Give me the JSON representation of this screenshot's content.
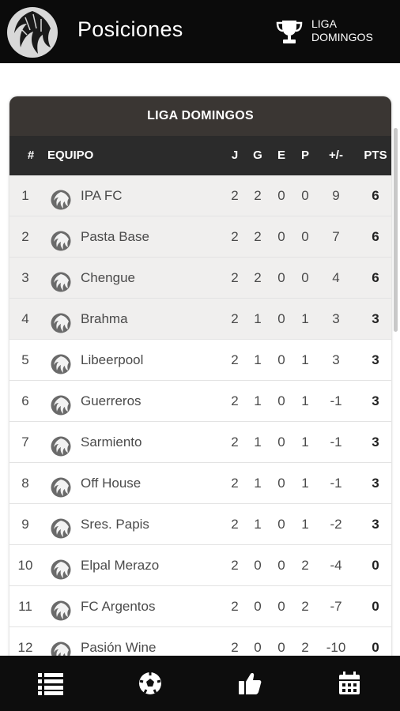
{
  "header": {
    "title": "Posiciones",
    "league_button": "LIGA DOMINGOS"
  },
  "table": {
    "title": "LIGA DOMINGOS",
    "columns": {
      "pos": "#",
      "team": "EQUIPO",
      "j": "J",
      "g": "G",
      "e": "E",
      "p": "P",
      "diff": "+/-",
      "pts": "PTS"
    },
    "rows": [
      {
        "pos": "1",
        "team": "IPA FC",
        "j": "2",
        "g": "2",
        "e": "0",
        "p": "0",
        "diff": "9",
        "pts": "6"
      },
      {
        "pos": "2",
        "team": "Pasta Base",
        "j": "2",
        "g": "2",
        "e": "0",
        "p": "0",
        "diff": "7",
        "pts": "6"
      },
      {
        "pos": "3",
        "team": "Chengue",
        "j": "2",
        "g": "2",
        "e": "0",
        "p": "0",
        "diff": "4",
        "pts": "6"
      },
      {
        "pos": "4",
        "team": "Brahma",
        "j": "2",
        "g": "1",
        "e": "0",
        "p": "1",
        "diff": "3",
        "pts": "3"
      },
      {
        "pos": "5",
        "team": "Libeerpool",
        "j": "2",
        "g": "1",
        "e": "0",
        "p": "1",
        "diff": "3",
        "pts": "3"
      },
      {
        "pos": "6",
        "team": "Guerreros",
        "j": "2",
        "g": "1",
        "e": "0",
        "p": "1",
        "diff": "-1",
        "pts": "3"
      },
      {
        "pos": "7",
        "team": "Sarmiento",
        "j": "2",
        "g": "1",
        "e": "0",
        "p": "1",
        "diff": "-1",
        "pts": "3"
      },
      {
        "pos": "8",
        "team": "Off House",
        "j": "2",
        "g": "1",
        "e": "0",
        "p": "1",
        "diff": "-1",
        "pts": "3"
      },
      {
        "pos": "9",
        "team": "Sres. Papis",
        "j": "2",
        "g": "1",
        "e": "0",
        "p": "1",
        "diff": "-2",
        "pts": "3"
      },
      {
        "pos": "10",
        "team": "Elpal Merazo",
        "j": "2",
        "g": "0",
        "e": "0",
        "p": "2",
        "diff": "-4",
        "pts": "0"
      },
      {
        "pos": "11",
        "team": "FC Argentos",
        "j": "2",
        "g": "0",
        "e": "0",
        "p": "2",
        "diff": "-7",
        "pts": "0"
      },
      {
        "pos": "12",
        "team": "Pasión Wine",
        "j": "2",
        "g": "0",
        "e": "0",
        "p": "2",
        "diff": "-10",
        "pts": "0"
      }
    ]
  },
  "bottom_nav": {
    "items": [
      "list-icon",
      "soccer-ball-icon",
      "thumbs-up-icon",
      "calendar-icon"
    ]
  },
  "colors": {
    "bar": "#0b0b0b",
    "card_title": "#3a3633",
    "table_header": "#2b2b2b",
    "shaded_row": "#f0efee"
  }
}
